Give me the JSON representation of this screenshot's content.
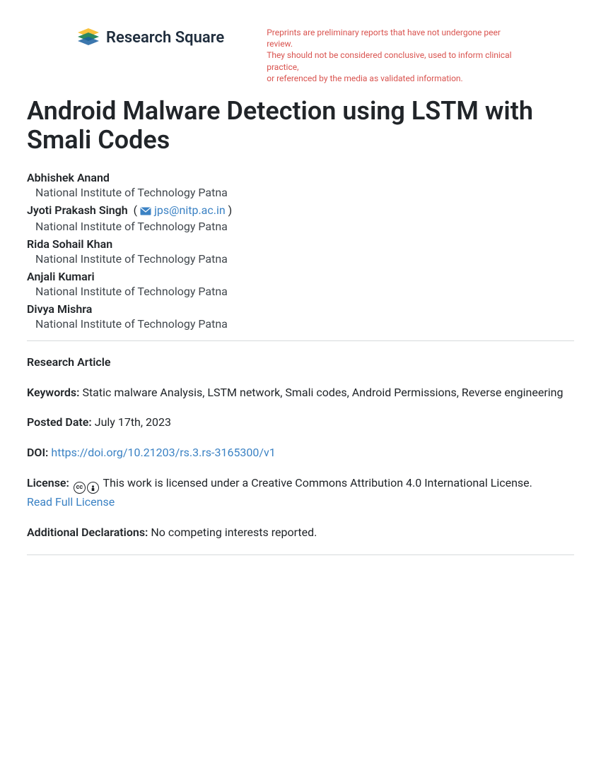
{
  "header": {
    "brand": "Research Square",
    "disclaimer_l1": "Preprints are preliminary reports that have not undergone peer review.",
    "disclaimer_l2": "They should not be considered conclusive, used to inform clinical practice,",
    "disclaimer_l3": "or referenced by the media as validated information."
  },
  "title": "Android Malware Detection using LSTM with Smali Codes",
  "authors": [
    {
      "name": "Abhishek Anand",
      "affiliation": "National Institute of Technology Patna",
      "email": null
    },
    {
      "name": "Jyoti Prakash Singh",
      "affiliation": "National Institute of Technology Patna",
      "email": "jps@nitp.ac.in"
    },
    {
      "name": "Rida Sohail Khan",
      "affiliation": "National Institute of Technology Patna",
      "email": null
    },
    {
      "name": "Anjali Kumari",
      "affiliation": "National Institute of Technology Patna",
      "email": null
    },
    {
      "name": "Divya Mishra",
      "affiliation": "National Institute of Technology Patna",
      "email": null
    }
  ],
  "article_type": "Research Article",
  "keywords": {
    "label": "Keywords:",
    "value": "Static malware Analysis, LSTM network, Smali codes, Android Permissions, Reverse engineering"
  },
  "posted": {
    "label": "Posted Date:",
    "value": "July 17th, 2023"
  },
  "doi": {
    "label": "DOI:",
    "value": "https://doi.org/10.21203/rs.3.rs-3165300/v1"
  },
  "license": {
    "label": "License:",
    "text": "This work is licensed under a Creative Commons Attribution 4.0 International License.",
    "read_full": "Read Full License"
  },
  "declarations": {
    "label": "Additional Declarations:",
    "value": "No competing interests reported."
  }
}
